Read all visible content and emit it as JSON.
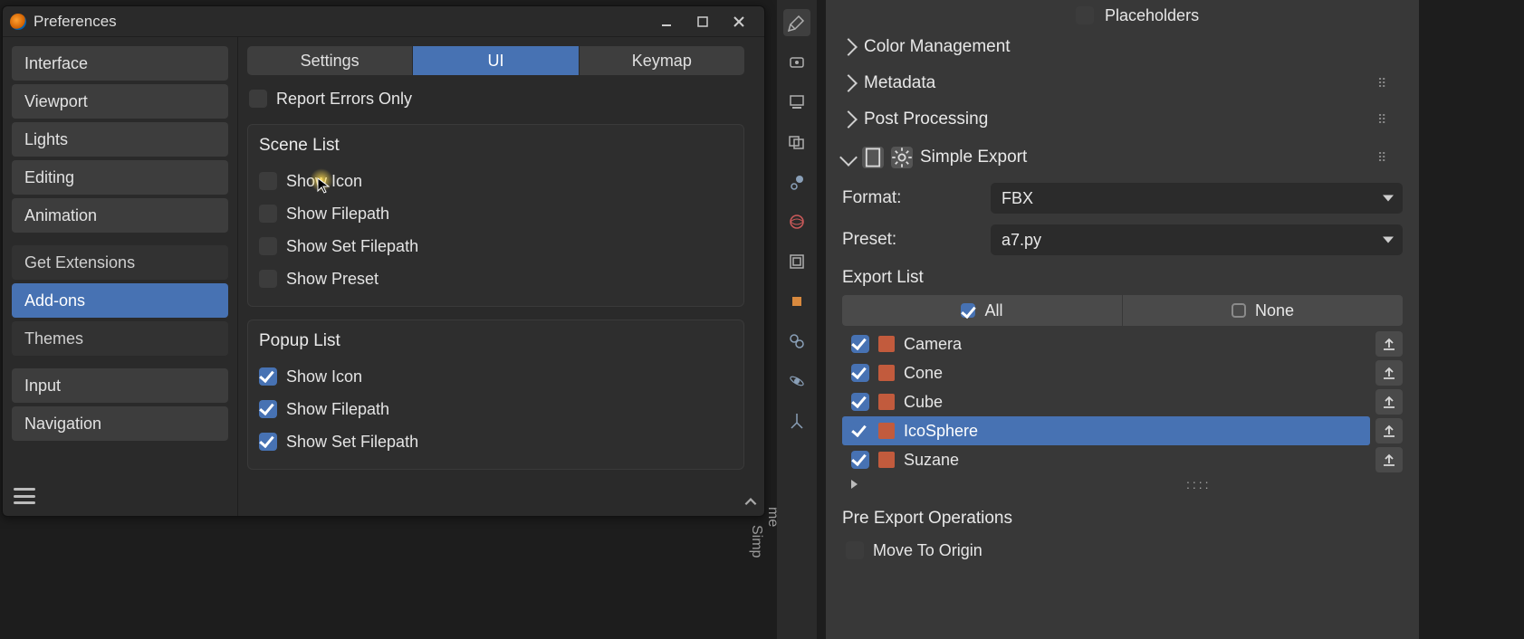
{
  "window": {
    "title": "Preferences"
  },
  "sidebar": {
    "items": [
      "Interface",
      "Viewport",
      "Lights",
      "Editing",
      "Animation",
      "Get Extensions",
      "Add-ons",
      "Themes",
      "Input",
      "Navigation"
    ]
  },
  "tabs": {
    "settings": "Settings",
    "ui": "UI",
    "keymap": "Keymap"
  },
  "report_errors_only": {
    "label": "Report Errors Only",
    "checked": false
  },
  "scene_list": {
    "title": "Scene List",
    "options": [
      {
        "label": "Show Icon",
        "checked": false
      },
      {
        "label": "Show Filepath",
        "checked": false
      },
      {
        "label": "Show Set Filepath",
        "checked": false
      },
      {
        "label": "Show Preset",
        "checked": false
      }
    ]
  },
  "popup_list": {
    "title": "Popup List",
    "options": [
      {
        "label": "Show Icon",
        "checked": true
      },
      {
        "label": "Show Filepath",
        "checked": true
      },
      {
        "label": "Show Set Filepath",
        "checked": true
      }
    ]
  },
  "vertical_labels": [
    "me",
    "Simp"
  ],
  "right": {
    "placeholders": {
      "checked": false,
      "label": "Placeholders"
    },
    "sections": {
      "color_mgmt": "Color Management",
      "metadata": "Metadata",
      "post_processing": "Post Processing",
      "simple_export": "Simple Export"
    },
    "format": {
      "label": "Format:",
      "value": "FBX"
    },
    "preset": {
      "label": "Preset:",
      "value": "a7.py"
    },
    "export_list_label": "Export List",
    "btn_all": "All",
    "btn_none": "None",
    "items": [
      {
        "name": "Camera",
        "checked": true,
        "selected": false
      },
      {
        "name": "Cone",
        "checked": true,
        "selected": false
      },
      {
        "name": "Cube",
        "checked": true,
        "selected": false
      },
      {
        "name": "IcoSphere",
        "checked": true,
        "selected": true
      },
      {
        "name": "Suzane",
        "checked": true,
        "selected": false
      }
    ],
    "pre_export": {
      "title": "Pre Export Operations",
      "move_to_origin": {
        "label": "Move To Origin",
        "checked": false
      }
    }
  }
}
